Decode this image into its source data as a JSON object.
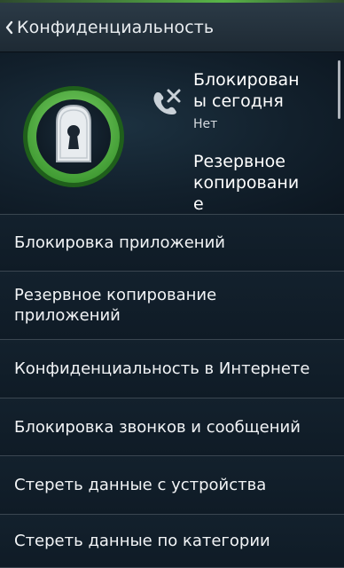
{
  "header": {
    "title": "Конфиденциальность"
  },
  "summary": {
    "blocked_today_label": "Блокирован\nы сегодня",
    "blocked_today_value": "Нет",
    "backup_label": "Резервное\nкопировани\nе"
  },
  "menu": {
    "items": [
      {
        "label": "Блокировка приложений"
      },
      {
        "label": "Резервное копирование приложений"
      },
      {
        "label": "Конфиденциальность в Интернете"
      },
      {
        "label": "Блокировка звонков и сообщений"
      },
      {
        "label": "Стереть данные с устройства"
      },
      {
        "label": "Стереть данные по категории"
      }
    ]
  },
  "colors": {
    "accent_green": "#59b548",
    "ring_dark": "#1f5f1b"
  }
}
